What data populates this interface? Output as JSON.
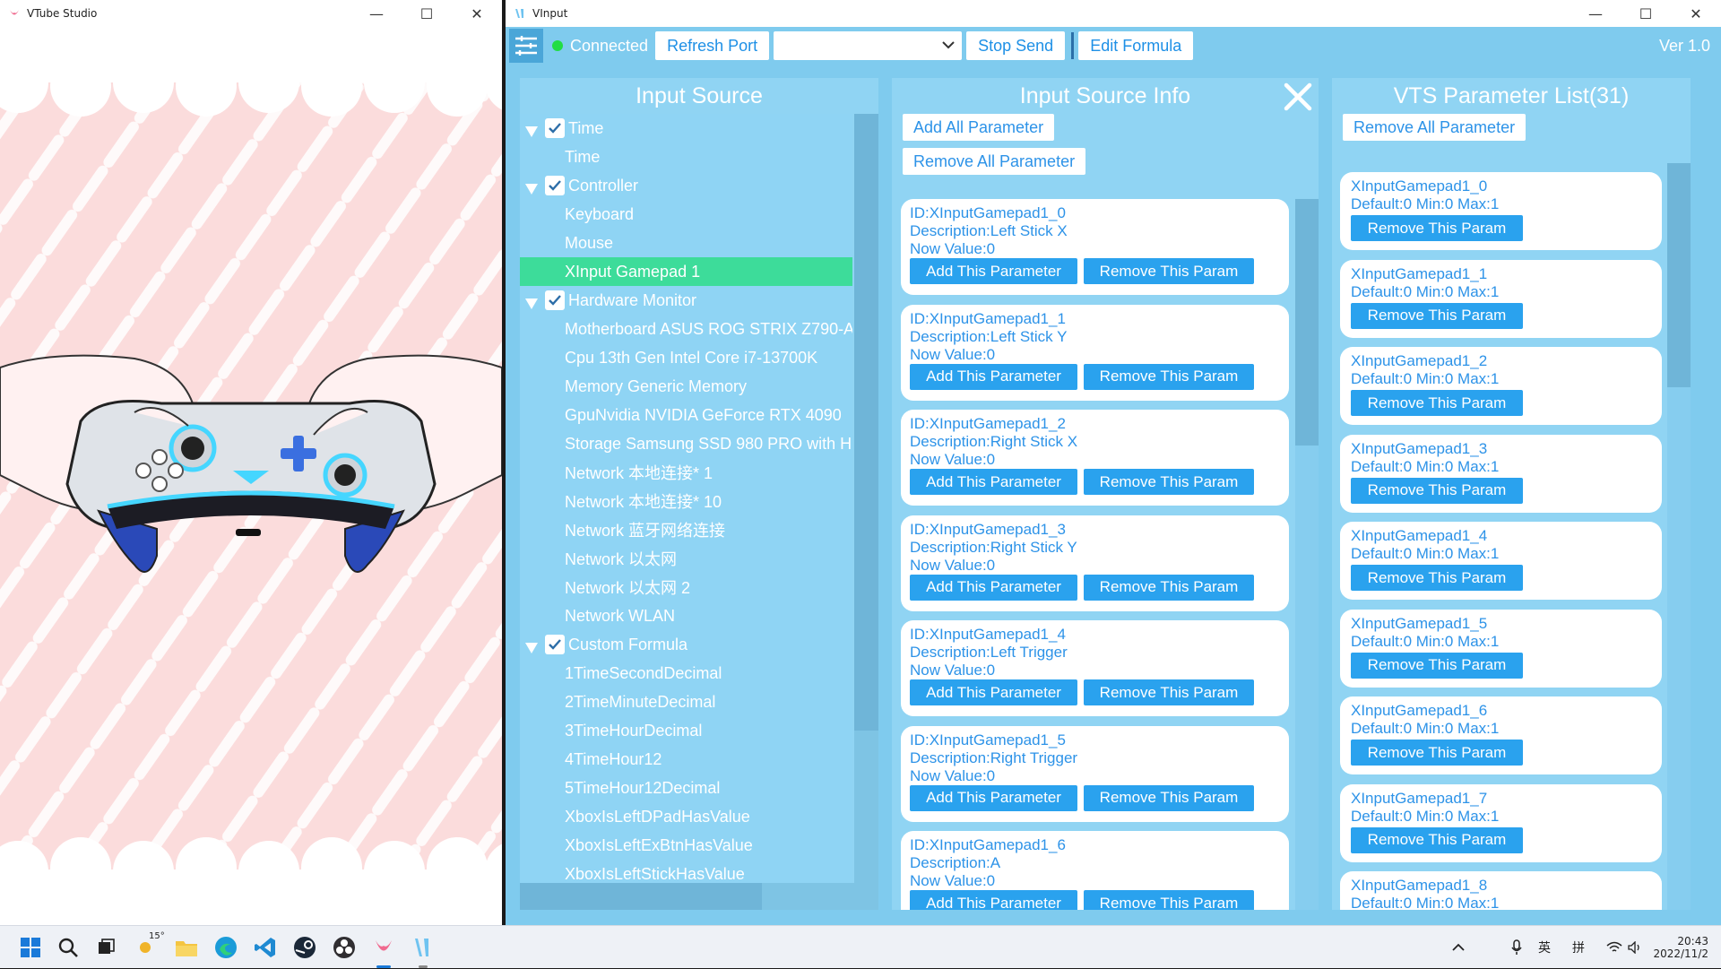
{
  "vts_window": {
    "title": "VTube Studio"
  },
  "vinput_window": {
    "title": "VInput"
  },
  "toolbar": {
    "status": "Connected",
    "status_color": "#22dd44",
    "refresh_port": "Refresh Port",
    "port_select_value": "",
    "stop_send": "Stop Send",
    "edit_formula": "Edit Formula",
    "version": "Ver 1.0"
  },
  "input_source": {
    "title": "Input Source",
    "items": [
      {
        "label": "Time",
        "level": 0,
        "expanded": true,
        "checked": true
      },
      {
        "label": "Time",
        "level": 1
      },
      {
        "label": "Controller",
        "level": 0,
        "expanded": true,
        "checked": true
      },
      {
        "label": "Keyboard",
        "level": 1
      },
      {
        "label": "Mouse",
        "level": 1
      },
      {
        "label": "XInput Gamepad 1",
        "level": 1,
        "selected": true
      },
      {
        "label": "Hardware Monitor",
        "level": 0,
        "expanded": true,
        "checked": true
      },
      {
        "label": "Motherboard ASUS ROG STRIX Z790-A",
        "level": 1
      },
      {
        "label": "Cpu 13th Gen Intel Core i7-13700K",
        "level": 1
      },
      {
        "label": "Memory Generic Memory",
        "level": 1
      },
      {
        "label": "GpuNvidia NVIDIA GeForce RTX 4090",
        "level": 1
      },
      {
        "label": "Storage Samsung SSD 980 PRO with H",
        "level": 1
      },
      {
        "label": "Network 本地连接* 1",
        "level": 1
      },
      {
        "label": "Network 本地连接* 10",
        "level": 1
      },
      {
        "label": "Network 蓝牙网络连接",
        "level": 1
      },
      {
        "label": "Network 以太网",
        "level": 1
      },
      {
        "label": "Network 以太网 2",
        "level": 1
      },
      {
        "label": "Network WLAN",
        "level": 1
      },
      {
        "label": "Custom Formula",
        "level": 0,
        "expanded": true,
        "checked": true
      },
      {
        "label": "1TimeSecondDecimal",
        "level": 1
      },
      {
        "label": "2TimeMinuteDecimal",
        "level": 1
      },
      {
        "label": "3TimeHourDecimal",
        "level": 1
      },
      {
        "label": "4TimeHour12",
        "level": 1
      },
      {
        "label": "5TimeHour12Decimal",
        "level": 1
      },
      {
        "label": "XboxIsLeftDPadHasValue",
        "level": 1
      },
      {
        "label": "XboxIsLeftExBtnHasValue",
        "level": 1
      },
      {
        "label": "XboxIsLeftStickHasValue",
        "level": 1
      }
    ]
  },
  "source_info": {
    "title": "Input Source Info",
    "add_all": "Add All Parameter",
    "remove_all": "Remove All Parameter",
    "add_label": "Add This Parameter",
    "remove_label": "Remove This Param",
    "cards": [
      {
        "id": "ID:XInputGamepad1_0",
        "desc": "Description:Left Stick X",
        "value": "Now Value:0"
      },
      {
        "id": "ID:XInputGamepad1_1",
        "desc": "Description:Left Stick Y",
        "value": "Now Value:0"
      },
      {
        "id": "ID:XInputGamepad1_2",
        "desc": "Description:Right Stick X",
        "value": "Now Value:0"
      },
      {
        "id": "ID:XInputGamepad1_3",
        "desc": "Description:Right Stick Y",
        "value": "Now Value:0"
      },
      {
        "id": "ID:XInputGamepad1_4",
        "desc": "Description:Left Trigger",
        "value": "Now Value:0"
      },
      {
        "id": "ID:XInputGamepad1_5",
        "desc": "Description:Right Trigger",
        "value": "Now Value:0"
      },
      {
        "id": "ID:XInputGamepad1_6",
        "desc": "Description:A",
        "value": "Now Value:0"
      }
    ]
  },
  "vts_params": {
    "title": "VTS Parameter List(31)",
    "remove_all": "Remove All Parameter",
    "remove_label": "Remove This Param",
    "items": [
      {
        "name": "XInputGamepad1_0",
        "info": "Default:0 Min:0 Max:1"
      },
      {
        "name": "XInputGamepad1_1",
        "info": "Default:0 Min:0 Max:1"
      },
      {
        "name": "XInputGamepad1_2",
        "info": "Default:0 Min:0 Max:1"
      },
      {
        "name": "XInputGamepad1_3",
        "info": "Default:0 Min:0 Max:1"
      },
      {
        "name": "XInputGamepad1_4",
        "info": "Default:0 Min:0 Max:1"
      },
      {
        "name": "XInputGamepad1_5",
        "info": "Default:0 Min:0 Max:1"
      },
      {
        "name": "XInputGamepad1_6",
        "info": "Default:0 Min:0 Max:1"
      },
      {
        "name": "XInputGamepad1_7",
        "info": "Default:0 Min:0 Max:1"
      },
      {
        "name": "XInputGamepad1_8",
        "info": "Default:0 Min:0 Max:1"
      }
    ]
  },
  "taskbar": {
    "weather": "15°",
    "ime_lang": "英",
    "ime_mode": "拼",
    "time": "20:43",
    "date": "2022/11/2"
  },
  "colors": {
    "app_bg": "#7fcbee",
    "panel_bg": "#90d4f3",
    "selected": "#3ddc9a",
    "button_blue": "#2aa2ee",
    "text_blue": "#2d93e8"
  }
}
